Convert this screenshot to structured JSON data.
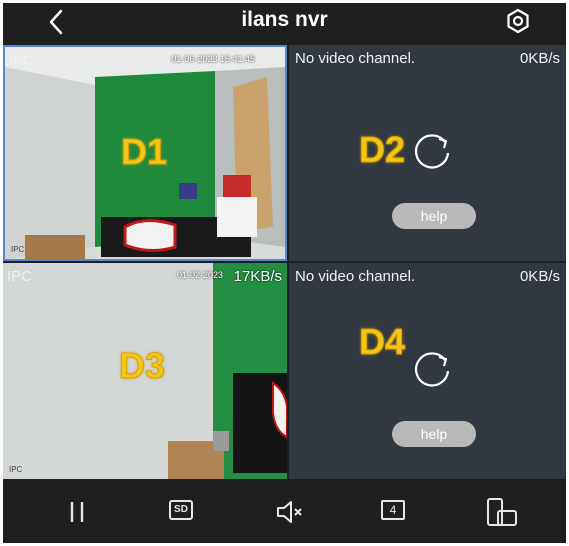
{
  "header": {
    "title": "ilans nvr",
    "back_icon": "chevron-left-icon",
    "settings_icon": "gear-icon"
  },
  "channels": [
    {
      "id": "D1",
      "label": "IPC",
      "osd_text": "01-06-2023 15:41:45",
      "rate": "",
      "cam_label": "IPC",
      "state": "live"
    },
    {
      "id": "D2",
      "message": "No video channel.",
      "rate": "0KB/s",
      "help": "help",
      "state": "no-video"
    },
    {
      "id": "D3",
      "label": "IPC",
      "osd_text": "01-02-2023",
      "rate": "17KB/s",
      "cam_label": "IPC",
      "state": "live"
    },
    {
      "id": "D4",
      "message": "No video channel.",
      "rate": "0KB/s",
      "help": "help",
      "state": "no-video"
    }
  ],
  "toolbar": {
    "pause_icon": "pause-icon",
    "sd_label": "SD",
    "mute_icon": "speaker-muted-icon",
    "split_label": "4",
    "rotate_icon": "phone-rotate-icon"
  },
  "colors": {
    "accent_badge": "#f5c518",
    "selected_border": "#5b86c7",
    "help_button": "#b9b9b9"
  }
}
